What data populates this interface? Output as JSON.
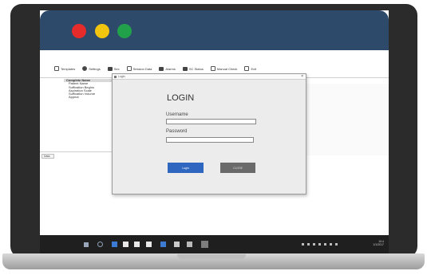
{
  "window_controls": {
    "close_color": "#e62b2b",
    "minimize_color": "#f1c40f",
    "maximize_color": "#21a24a",
    "titlebar_color": "#2e4a6b"
  },
  "toolbar": {
    "items": [
      {
        "label": "Templates",
        "icon": "templates-icon"
      },
      {
        "label": "Settings",
        "icon": "gear-icon"
      },
      {
        "label": "Sex",
        "icon": "sex-icon"
      },
      {
        "label": "Session Data",
        "icon": "session-data-icon"
      },
      {
        "label": "Alarms",
        "icon": "alarm-icon"
      },
      {
        "label": "SC Status",
        "icon": "status-icon"
      },
      {
        "label": "Manual Check",
        "icon": "manual-check-icon"
      },
      {
        "label": "Exit",
        "icon": "exit-icon"
      }
    ]
  },
  "tree": {
    "header": "Complete Name",
    "nodes": [
      "Patient Name",
      "Suffixation Begins",
      "Aspiration Scale",
      "Suffixation Volume",
      "Appeal"
    ]
  },
  "side_tab": {
    "label": "Data"
  },
  "dialog": {
    "title": "Login",
    "close_glyph": "×",
    "heading": "LOGIN",
    "username_label": "Username",
    "username_value": "",
    "password_label": "Password",
    "password_value": "",
    "login_button": "Login",
    "close_button": "CLOSE",
    "login_button_color": "#2e66c0",
    "close_button_color": "#6a6a6a"
  },
  "taskbar": {
    "icons": [
      "windows-start-icon",
      "search-icon",
      "edge-icon",
      "file-explorer-icon",
      "store-icon",
      "mail-icon",
      "word-icon",
      "photos-icon",
      "settings-icon",
      "app-icon"
    ],
    "time": "10:4",
    "date": "1/1/2017"
  }
}
